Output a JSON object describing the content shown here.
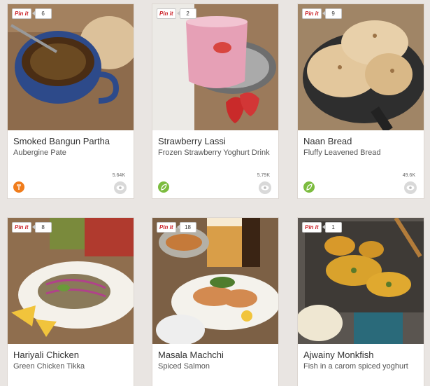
{
  "pin_label": "Pin it",
  "cards": [
    {
      "title": "Smoked Bangun Partha",
      "subtitle": "Aubergine Pate",
      "pins": "6",
      "views": "5.64K",
      "category_icon": "fork-knife-icon",
      "category_color": "#f07c1b"
    },
    {
      "title": "Strawberry Lassi",
      "subtitle": "Frozen Strawberry Yoghurt Drink",
      "pins": "2",
      "views": "5.79K",
      "category_icon": "leaf-icon",
      "category_color": "#7cbc3f"
    },
    {
      "title": "Naan Bread",
      "subtitle": "Fluffy Leavened Bread",
      "pins": "9",
      "views": "49.6K",
      "category_icon": "leaf-icon",
      "category_color": "#7cbc3f"
    },
    {
      "title": "Hariyali Chicken",
      "subtitle": "Green Chicken Tikka",
      "pins": "8",
      "views": "",
      "category_icon": "",
      "category_color": ""
    },
    {
      "title": "Masala Machchi",
      "subtitle": "Spiced Salmon",
      "pins": "18",
      "views": "",
      "category_icon": "",
      "category_color": ""
    },
    {
      "title": "Ajwainy Monkfish",
      "subtitle": "Fish in a carom spiced yoghurt",
      "pins": "1",
      "views": "",
      "category_icon": "",
      "category_color": ""
    }
  ]
}
